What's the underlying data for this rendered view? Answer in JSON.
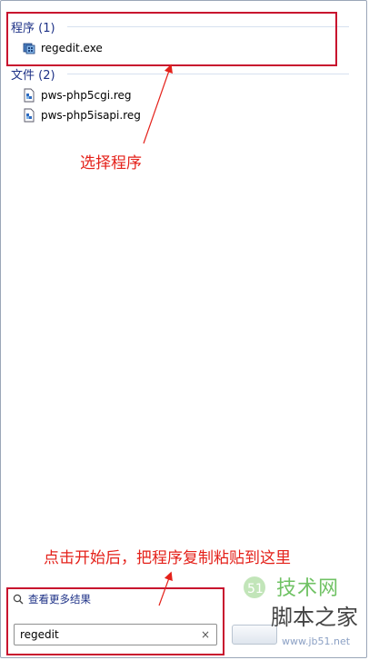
{
  "results": {
    "programs_header": "程序 (1)",
    "programs": [
      {
        "label": "regedit.exe",
        "icon": "regedit-icon"
      }
    ],
    "files_header": "文件 (2)",
    "files": [
      {
        "label": "pws-php5cgi.reg",
        "icon": "reg-file-icon"
      },
      {
        "label": "pws-php5isapi.reg",
        "icon": "reg-file-icon"
      }
    ]
  },
  "annotations": {
    "select_program": "选择程序",
    "paste_instruction": "点击开始后，把程序复制粘贴到这里",
    "color": "#e4211a"
  },
  "more_results_label": "查看更多结果",
  "search": {
    "value": "regedit",
    "clear_glyph": "×"
  },
  "watermark": {
    "top": "技术网",
    "middle": "脚本之家",
    "bottom": "www.jb51.net"
  }
}
